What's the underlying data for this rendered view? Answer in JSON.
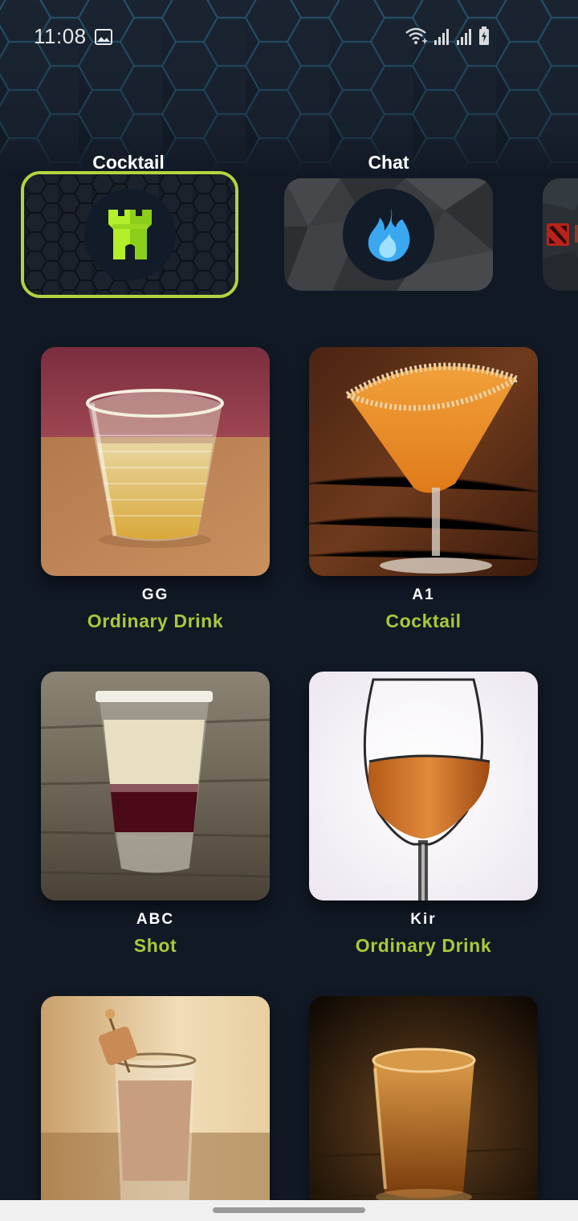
{
  "status_bar": {
    "time": "11:08",
    "icons": [
      "image-icon",
      "wifi-icon",
      "signal-icon",
      "signal-icon",
      "battery-charging-icon"
    ]
  },
  "categories": [
    {
      "label": "Cocktail",
      "icon": "castle-tower-icon",
      "selected": true
    },
    {
      "label": "Chat",
      "icon": "flame-icon",
      "selected": false
    },
    {
      "label": "",
      "icon": "dota-logo-icon",
      "selected": false
    }
  ],
  "drinks": [
    {
      "name": "GG",
      "category": "Ordinary Drink"
    },
    {
      "name": "A1",
      "category": "Cocktail"
    },
    {
      "name": "ABC",
      "category": "Shot"
    },
    {
      "name": "Kir",
      "category": "Ordinary Drink"
    },
    {
      "name": "",
      "category": ""
    },
    {
      "name": "",
      "category": ""
    }
  ],
  "colors": {
    "background": "#111925",
    "accent_green": "#a9c93a",
    "selected_border": "#b5d33f",
    "tower_icon": "#b4f02a",
    "flame_icon": "#3aa8f0",
    "text_white": "#ffffff"
  }
}
